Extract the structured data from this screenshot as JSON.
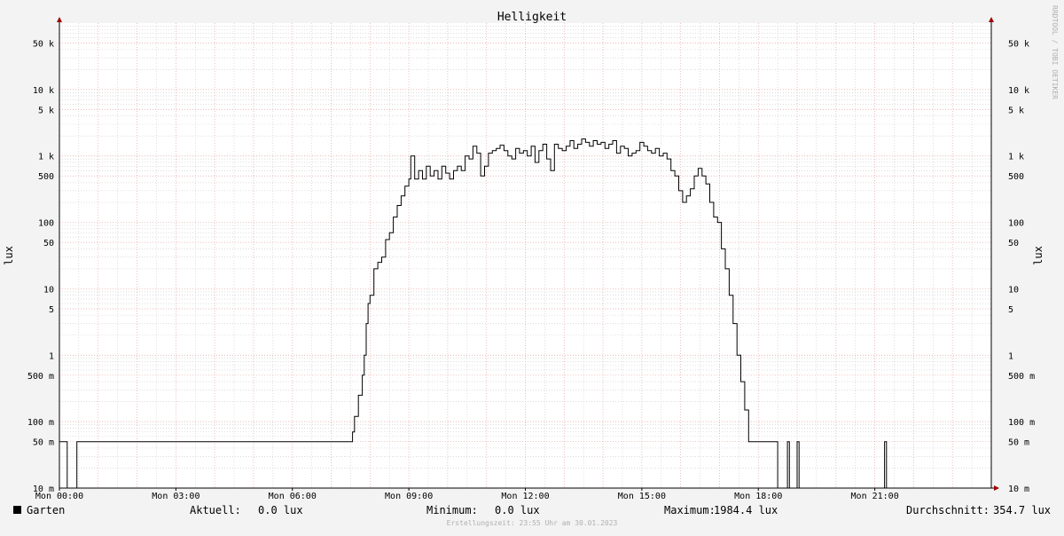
{
  "chart_data": {
    "type": "line",
    "title": "Helligkeit",
    "ylabel": "lux",
    "ylabel_right": "lux",
    "y_scale": "log",
    "ylim": [
      0.01,
      100000
    ],
    "x_unit": "hours",
    "xlim": [
      0,
      24
    ],
    "grid": true,
    "legend_position": "bottom",
    "x_ticks": [
      {
        "v": 0,
        "label": "Mon 00:00"
      },
      {
        "v": 3,
        "label": "Mon 03:00"
      },
      {
        "v": 6,
        "label": "Mon 06:00"
      },
      {
        "v": 9,
        "label": "Mon 09:00"
      },
      {
        "v": 12,
        "label": "Mon 12:00"
      },
      {
        "v": 15,
        "label": "Mon 15:00"
      },
      {
        "v": 18,
        "label": "Mon 18:00"
      },
      {
        "v": 21,
        "label": "Mon 21:00"
      }
    ],
    "y_ticks": [
      {
        "v": 0.01,
        "label": "10 m"
      },
      {
        "v": 0.05,
        "label": "50 m"
      },
      {
        "v": 0.1,
        "label": "100 m"
      },
      {
        "v": 0.5,
        "label": "500 m"
      },
      {
        "v": 1,
        "label": "1"
      },
      {
        "v": 5,
        "label": "5"
      },
      {
        "v": 10,
        "label": "10"
      },
      {
        "v": 50,
        "label": "50"
      },
      {
        "v": 100,
        "label": "100"
      },
      {
        "v": 500,
        "label": "500"
      },
      {
        "v": 1000,
        "label": "1 k"
      },
      {
        "v": 5000,
        "label": "5 k"
      },
      {
        "v": 10000,
        "label": "10 k"
      },
      {
        "v": 50000,
        "label": "50 k"
      }
    ],
    "series": [
      {
        "name": "Garten",
        "color": "#000000",
        "step": true,
        "points": [
          [
            0.0,
            0.05
          ],
          [
            0.2,
            0.01
          ],
          [
            0.45,
            0.05
          ],
          [
            7.5,
            0.05
          ],
          [
            7.55,
            0.07
          ],
          [
            7.6,
            0.12
          ],
          [
            7.7,
            0.25
          ],
          [
            7.8,
            0.5
          ],
          [
            7.85,
            1
          ],
          [
            7.9,
            3
          ],
          [
            7.95,
            6
          ],
          [
            8.0,
            8
          ],
          [
            8.1,
            20
          ],
          [
            8.2,
            25
          ],
          [
            8.3,
            30
          ],
          [
            8.4,
            55
          ],
          [
            8.5,
            70
          ],
          [
            8.6,
            120
          ],
          [
            8.7,
            180
          ],
          [
            8.8,
            250
          ],
          [
            8.9,
            350
          ],
          [
            9.0,
            450
          ],
          [
            9.05,
            1000
          ],
          [
            9.15,
            450
          ],
          [
            9.25,
            600
          ],
          [
            9.35,
            450
          ],
          [
            9.45,
            700
          ],
          [
            9.55,
            500
          ],
          [
            9.65,
            600
          ],
          [
            9.75,
            450
          ],
          [
            9.85,
            700
          ],
          [
            9.95,
            550
          ],
          [
            10.05,
            450
          ],
          [
            10.15,
            600
          ],
          [
            10.25,
            700
          ],
          [
            10.35,
            600
          ],
          [
            10.45,
            1000
          ],
          [
            10.55,
            900
          ],
          [
            10.65,
            1400
          ],
          [
            10.75,
            1100
          ],
          [
            10.85,
            500
          ],
          [
            10.95,
            700
          ],
          [
            11.05,
            1100
          ],
          [
            11.15,
            1200
          ],
          [
            11.25,
            1300
          ],
          [
            11.35,
            1450
          ],
          [
            11.45,
            1200
          ],
          [
            11.55,
            1000
          ],
          [
            11.65,
            900
          ],
          [
            11.75,
            1300
          ],
          [
            11.85,
            1100
          ],
          [
            11.95,
            1200
          ],
          [
            12.05,
            1000
          ],
          [
            12.15,
            1400
          ],
          [
            12.25,
            800
          ],
          [
            12.35,
            1200
          ],
          [
            12.45,
            1500
          ],
          [
            12.55,
            900
          ],
          [
            12.65,
            600
          ],
          [
            12.75,
            1500
          ],
          [
            12.85,
            1300
          ],
          [
            12.95,
            1200
          ],
          [
            13.05,
            1400
          ],
          [
            13.15,
            1700
          ],
          [
            13.25,
            1300
          ],
          [
            13.35,
            1500
          ],
          [
            13.45,
            1800
          ],
          [
            13.55,
            1600
          ],
          [
            13.65,
            1400
          ],
          [
            13.75,
            1700
          ],
          [
            13.85,
            1500
          ],
          [
            13.95,
            1600
          ],
          [
            14.05,
            1300
          ],
          [
            14.15,
            1500
          ],
          [
            14.25,
            1700
          ],
          [
            14.35,
            1100
          ],
          [
            14.45,
            1400
          ],
          [
            14.55,
            1300
          ],
          [
            14.65,
            1000
          ],
          [
            14.75,
            1100
          ],
          [
            14.85,
            1200
          ],
          [
            14.95,
            1600
          ],
          [
            15.05,
            1400
          ],
          [
            15.15,
            1200
          ],
          [
            15.25,
            1100
          ],
          [
            15.35,
            1300
          ],
          [
            15.45,
            1000
          ],
          [
            15.55,
            1100
          ],
          [
            15.65,
            900
          ],
          [
            15.75,
            600
          ],
          [
            15.85,
            500
          ],
          [
            15.95,
            300
          ],
          [
            16.05,
            200
          ],
          [
            16.15,
            250
          ],
          [
            16.25,
            320
          ],
          [
            16.35,
            500
          ],
          [
            16.45,
            650
          ],
          [
            16.55,
            500
          ],
          [
            16.65,
            380
          ],
          [
            16.75,
            200
          ],
          [
            16.85,
            120
          ],
          [
            16.95,
            100
          ],
          [
            17.05,
            40
          ],
          [
            17.15,
            20
          ],
          [
            17.25,
            8
          ],
          [
            17.35,
            3
          ],
          [
            17.45,
            1
          ],
          [
            17.55,
            0.4
          ],
          [
            17.65,
            0.15
          ],
          [
            17.75,
            0.05
          ],
          [
            18.1,
            0.05
          ],
          [
            18.5,
            0.01
          ],
          [
            18.75,
            0.05
          ],
          [
            18.8,
            0.01
          ],
          [
            19.0,
            0.05
          ],
          [
            19.05,
            0.01
          ],
          [
            21.25,
            0.05
          ],
          [
            21.3,
            0.01
          ],
          [
            24.0,
            0.01
          ]
        ]
      }
    ]
  },
  "legend": {
    "series_name": "Garten",
    "aktuell_label": "Aktuell:",
    "aktuell_value": "0.0 lux",
    "minimum_label": "Minimum:",
    "minimum_value": "0.0 lux",
    "maximum_label": "Maximum:",
    "maximum_value": "1984.4 lux",
    "durchschnitt_label": "Durchschnitt:",
    "durchschnitt_value": "354.7 lux"
  },
  "footer": {
    "created_text": "Erstellungszeit: 23:55 Uhr am 30.01.2023"
  },
  "watermark": "RRDTOOL / TOBI OETIKER",
  "colors": {
    "background": "#f3f3f3",
    "plot_background": "#ffffff",
    "major_grid": "#e8a0a0",
    "minor_grid": "#c8c8c8",
    "line": "#000000",
    "axis_arrow": "#a00000"
  }
}
